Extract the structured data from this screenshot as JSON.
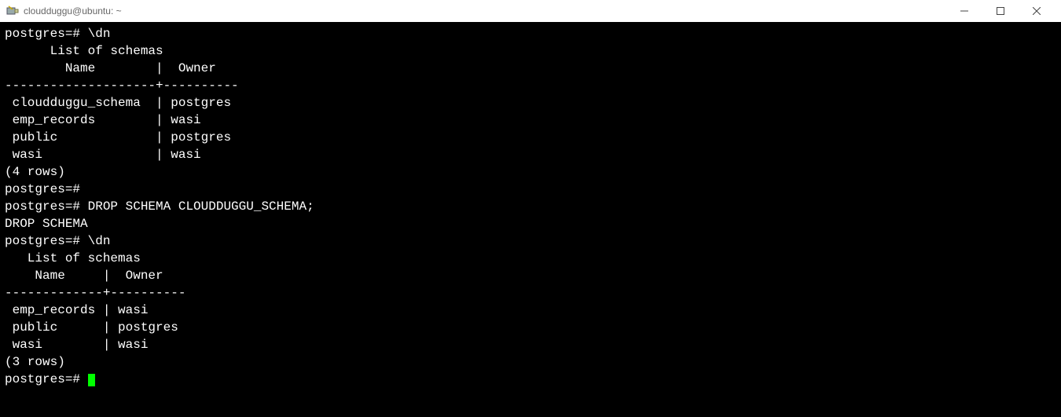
{
  "titlebar": {
    "title": "cloudduggu@ubuntu: ~"
  },
  "terminal": {
    "lines": [
      "postgres=# \\dn",
      "      List of schemas",
      "        Name        |  Owner",
      "--------------------+----------",
      " cloudduggu_schema  | postgres",
      " emp_records        | wasi",
      " public             | postgres",
      " wasi               | wasi",
      "(4 rows)",
      "",
      "postgres=#",
      "postgres=# DROP SCHEMA CLOUDDUGGU_SCHEMA;",
      "DROP SCHEMA",
      "postgres=# \\dn",
      "   List of schemas",
      "    Name     |  Owner",
      "-------------+----------",
      " emp_records | wasi",
      " public      | postgres",
      " wasi        | wasi",
      "(3 rows)",
      "",
      "postgres=# "
    ]
  }
}
